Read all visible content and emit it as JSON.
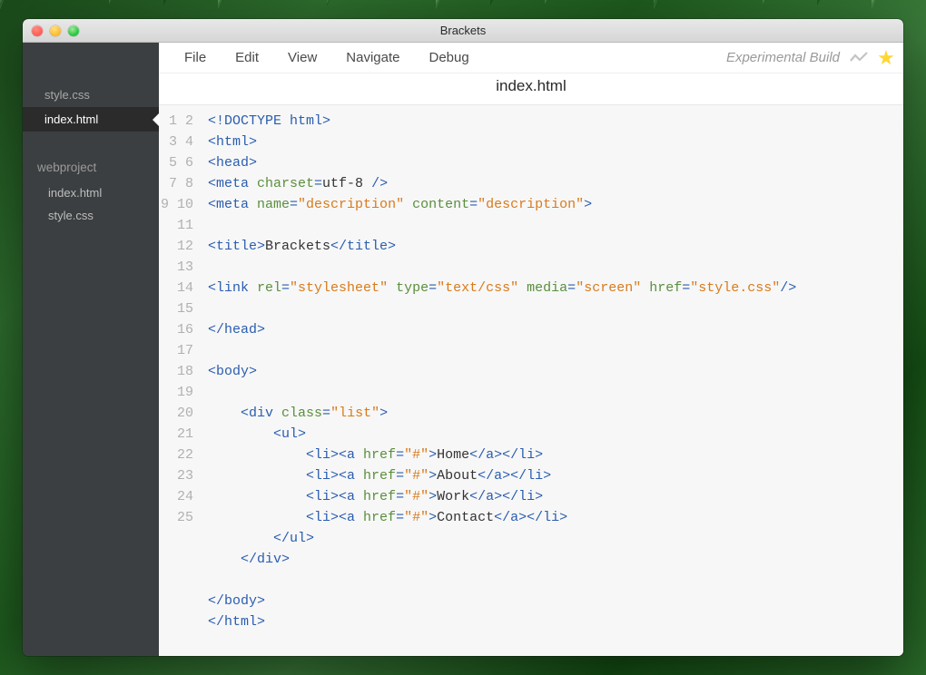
{
  "window": {
    "title": "Brackets"
  },
  "sidebar": {
    "working_files": [
      {
        "name": "style.css",
        "active": false
      },
      {
        "name": "index.html",
        "active": true
      }
    ],
    "project": {
      "name": "webproject",
      "files": [
        {
          "name": "index.html"
        },
        {
          "name": "style.css"
        }
      ]
    }
  },
  "menu": {
    "items": [
      "File",
      "Edit",
      "View",
      "Navigate",
      "Debug"
    ],
    "experimental_label": "Experimental Build"
  },
  "open_file": {
    "name": "index.html"
  },
  "code_lines": [
    [
      {
        "t": "tag",
        "v": "<!DOCTYPE html>"
      }
    ],
    [
      {
        "t": "tag",
        "v": "<html>"
      }
    ],
    [
      {
        "t": "tag",
        "v": "<head>"
      }
    ],
    [
      {
        "t": "tag",
        "v": "<meta "
      },
      {
        "t": "attr",
        "v": "charset"
      },
      {
        "t": "tag",
        "v": "="
      },
      {
        "t": "nv",
        "v": "utf-8"
      },
      {
        "t": "tag",
        "v": " />"
      }
    ],
    [
      {
        "t": "tag",
        "v": "<meta "
      },
      {
        "t": "attr",
        "v": "name"
      },
      {
        "t": "tag",
        "v": "="
      },
      {
        "t": "str",
        "v": "\"description\""
      },
      {
        "t": "tag",
        "v": " "
      },
      {
        "t": "attr",
        "v": "content"
      },
      {
        "t": "tag",
        "v": "="
      },
      {
        "t": "str",
        "v": "\"description\""
      },
      {
        "t": "tag",
        "v": ">"
      }
    ],
    [],
    [
      {
        "t": "tag",
        "v": "<title>"
      },
      {
        "t": "text",
        "v": "Brackets"
      },
      {
        "t": "tag",
        "v": "</title>"
      }
    ],
    [],
    [
      {
        "t": "tag",
        "v": "<link "
      },
      {
        "t": "attr",
        "v": "rel"
      },
      {
        "t": "tag",
        "v": "="
      },
      {
        "t": "str",
        "v": "\"stylesheet\""
      },
      {
        "t": "tag",
        "v": " "
      },
      {
        "t": "attr",
        "v": "type"
      },
      {
        "t": "tag",
        "v": "="
      },
      {
        "t": "str",
        "v": "\"text/css\""
      },
      {
        "t": "tag",
        "v": " "
      },
      {
        "t": "attr",
        "v": "media"
      },
      {
        "t": "tag",
        "v": "="
      },
      {
        "t": "str",
        "v": "\"screen\""
      },
      {
        "t": "tag",
        "v": " "
      },
      {
        "t": "attr",
        "v": "href"
      },
      {
        "t": "tag",
        "v": "="
      },
      {
        "t": "str",
        "v": "\"style.css\""
      },
      {
        "t": "tag",
        "v": "/>"
      }
    ],
    [],
    [
      {
        "t": "tag",
        "v": "</head>"
      }
    ],
    [],
    [
      {
        "t": "tag",
        "v": "<body>"
      }
    ],
    [],
    [
      {
        "t": "text",
        "v": "    "
      },
      {
        "t": "tag",
        "v": "<div "
      },
      {
        "t": "attr",
        "v": "class"
      },
      {
        "t": "tag",
        "v": "="
      },
      {
        "t": "str",
        "v": "\"list\""
      },
      {
        "t": "tag",
        "v": ">"
      }
    ],
    [
      {
        "t": "text",
        "v": "        "
      },
      {
        "t": "tag",
        "v": "<ul>"
      }
    ],
    [
      {
        "t": "text",
        "v": "            "
      },
      {
        "t": "tag",
        "v": "<li><a "
      },
      {
        "t": "attr",
        "v": "href"
      },
      {
        "t": "tag",
        "v": "="
      },
      {
        "t": "str",
        "v": "\"#\""
      },
      {
        "t": "tag",
        "v": ">"
      },
      {
        "t": "text",
        "v": "Home"
      },
      {
        "t": "tag",
        "v": "</a></li>"
      }
    ],
    [
      {
        "t": "text",
        "v": "            "
      },
      {
        "t": "tag",
        "v": "<li><a "
      },
      {
        "t": "attr",
        "v": "href"
      },
      {
        "t": "tag",
        "v": "="
      },
      {
        "t": "str",
        "v": "\"#\""
      },
      {
        "t": "tag",
        "v": ">"
      },
      {
        "t": "text",
        "v": "About"
      },
      {
        "t": "tag",
        "v": "</a></li>"
      }
    ],
    [
      {
        "t": "text",
        "v": "            "
      },
      {
        "t": "tag",
        "v": "<li><a "
      },
      {
        "t": "attr",
        "v": "href"
      },
      {
        "t": "tag",
        "v": "="
      },
      {
        "t": "str",
        "v": "\"#\""
      },
      {
        "t": "tag",
        "v": ">"
      },
      {
        "t": "text",
        "v": "Work"
      },
      {
        "t": "tag",
        "v": "</a></li>"
      }
    ],
    [
      {
        "t": "text",
        "v": "            "
      },
      {
        "t": "tag",
        "v": "<li><a "
      },
      {
        "t": "attr",
        "v": "href"
      },
      {
        "t": "tag",
        "v": "="
      },
      {
        "t": "str",
        "v": "\"#\""
      },
      {
        "t": "tag",
        "v": ">"
      },
      {
        "t": "text",
        "v": "Contact"
      },
      {
        "t": "tag",
        "v": "</a></li>"
      }
    ],
    [
      {
        "t": "text",
        "v": "        "
      },
      {
        "t": "tag",
        "v": "</ul>"
      }
    ],
    [
      {
        "t": "text",
        "v": "    "
      },
      {
        "t": "tag",
        "v": "</div>"
      }
    ],
    [],
    [
      {
        "t": "tag",
        "v": "</body>"
      }
    ],
    [
      {
        "t": "tag",
        "v": "</html>"
      }
    ]
  ]
}
